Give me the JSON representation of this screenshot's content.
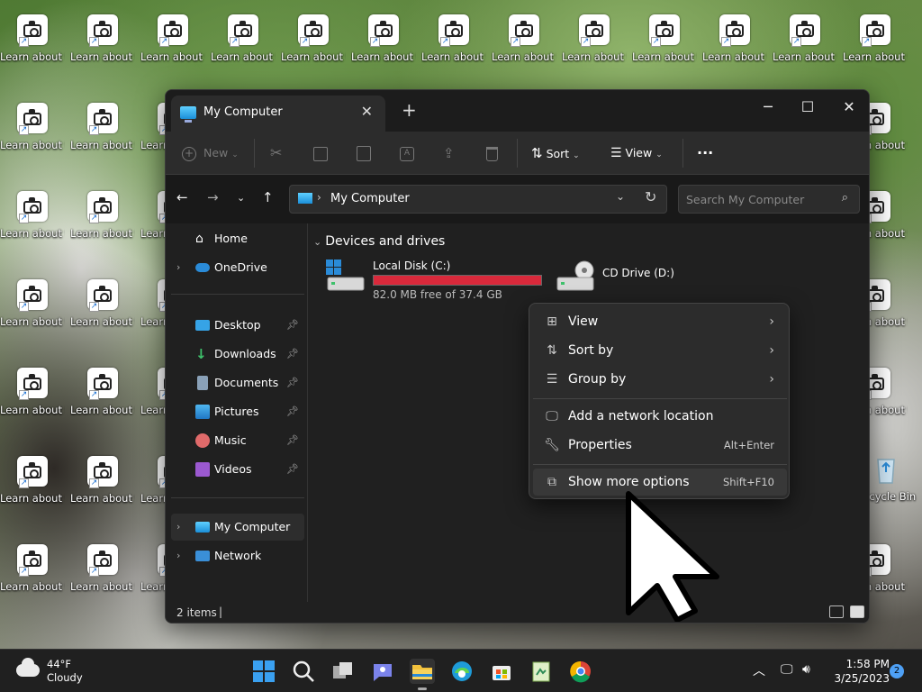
{
  "desktop": {
    "icon_label": "Learn about this pictur...",
    "recycle_bin_label": "Recycle Bin"
  },
  "window": {
    "tab_title": "My Computer",
    "commands": {
      "new": "New",
      "sort": "Sort",
      "view": "View"
    },
    "address": {
      "path": "My Computer"
    },
    "search": {
      "placeholder": "Search My Computer"
    },
    "sidebar": {
      "items": [
        {
          "label": "Home"
        },
        {
          "label": "OneDrive"
        },
        {
          "label": "Desktop"
        },
        {
          "label": "Downloads"
        },
        {
          "label": "Documents"
        },
        {
          "label": "Pictures"
        },
        {
          "label": "Music"
        },
        {
          "label": "Videos"
        },
        {
          "label": "My Computer"
        },
        {
          "label": "Network"
        }
      ]
    },
    "group_header": "Devices and drives",
    "drives": [
      {
        "name": "Local Disk (C:)",
        "free_text": "82.0 MB free of 37.4 GB",
        "used_fraction": 0.998
      },
      {
        "name": "CD Drive (D:)"
      }
    ],
    "status": {
      "item_count": "2 items"
    }
  },
  "context_menu": {
    "items": [
      {
        "label": "View",
        "icon": "grid-icon",
        "submenu": true
      },
      {
        "label": "Sort by",
        "icon": "sort-icon",
        "submenu": true
      },
      {
        "label": "Group by",
        "icon": "group-icon",
        "submenu": true
      },
      {
        "label": "Add a network location",
        "icon": "network-location-icon"
      },
      {
        "label": "Properties",
        "icon": "wrench-icon",
        "shortcut": "Alt+Enter"
      },
      {
        "label": "Show more options",
        "icon": "more-options-icon",
        "shortcut": "Shift+F10"
      }
    ]
  },
  "taskbar": {
    "weather_temp": "44°F",
    "weather_desc": "Cloudy",
    "time": "1:58 PM",
    "date": "3/25/2023",
    "notification_count": "2"
  },
  "colors": {
    "drive_bar": "#d9293b",
    "accent": "#4ea0f5"
  }
}
